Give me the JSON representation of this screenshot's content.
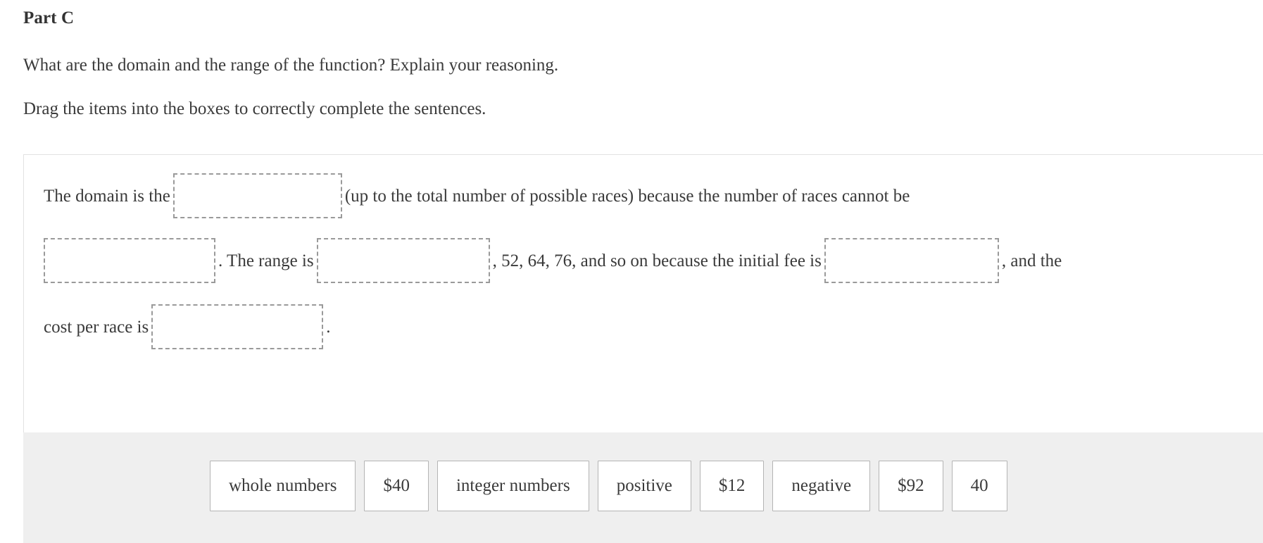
{
  "part_title": "Part C",
  "prompts": [
    "What are the domain and the range of the function? Explain your reasoning.",
    "Drag the items into the boxes to correctly complete the sentences."
  ],
  "sentence": {
    "line1": {
      "before_blank": "The domain is the",
      "after_blank": "(up to the total number of possible races) because the number of races cannot be"
    },
    "line2": {
      "after_blank1": ". The range is",
      "after_blank2": ", 52, 64, 76, and so on because the initial fee is",
      "after_blank3": ", and the"
    },
    "line3": {
      "before_blank": "cost per race is",
      "after_blank": "."
    }
  },
  "dropzones": [
    {
      "name": "domain-blank",
      "value": ""
    },
    {
      "name": "cannot-be-blank",
      "value": ""
    },
    {
      "name": "range-start-blank",
      "value": ""
    },
    {
      "name": "initial-fee-blank",
      "value": ""
    },
    {
      "name": "cost-per-race-blank",
      "value": ""
    }
  ],
  "tray": {
    "items": [
      "whole numbers",
      "$40",
      "integer numbers",
      "positive",
      "$12",
      "negative",
      "$92",
      "40"
    ]
  },
  "colors": {
    "page_background": "#ffffff",
    "tray_background": "#efefef",
    "text": "#3a3a3a",
    "title": "#333333",
    "panel_border": "#e2e2e2",
    "dropzone_border": "#9a9a9a",
    "tile_border": "#b4b4b4"
  }
}
